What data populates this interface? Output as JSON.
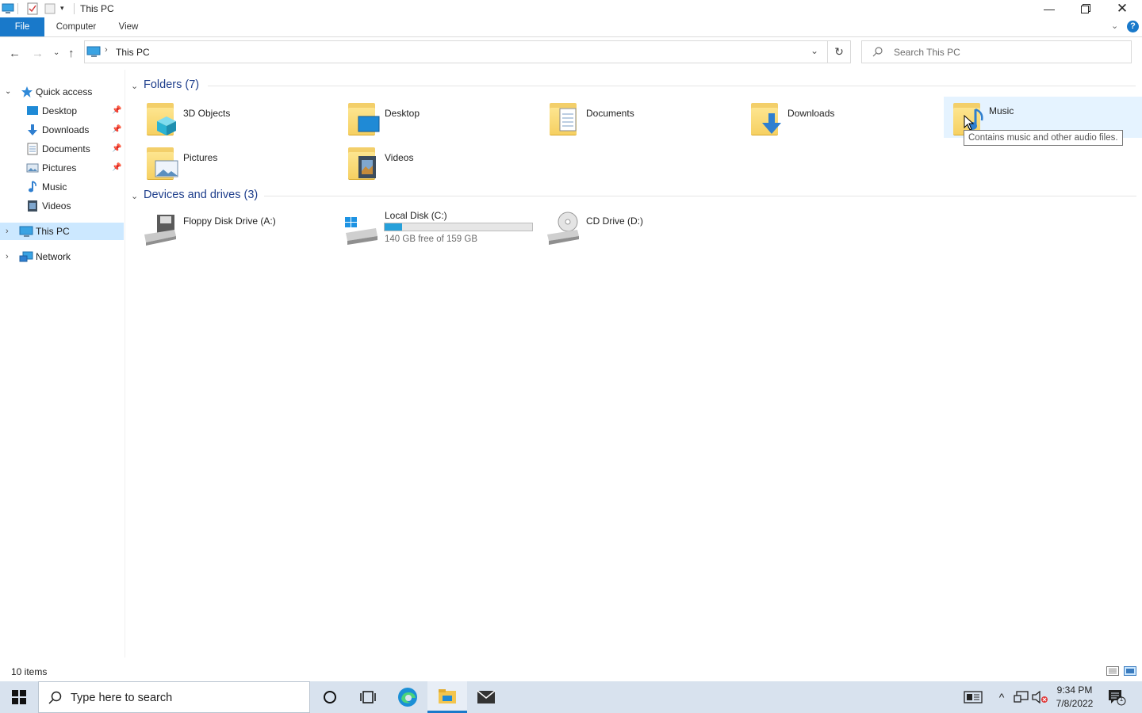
{
  "window": {
    "title": "This PC",
    "buttons": [
      "minimize",
      "restore",
      "close"
    ]
  },
  "ribbon": {
    "tabs": [
      {
        "label": "File",
        "active": true
      },
      {
        "label": "Computer"
      },
      {
        "label": "View"
      }
    ]
  },
  "address": {
    "path": "This PC",
    "search_placeholder": "Search This PC"
  },
  "nav_pane": {
    "quick_access": "Quick access",
    "pinned": [
      {
        "label": "Desktop",
        "icon": "desktop-icon",
        "pinned": true
      },
      {
        "label": "Downloads",
        "icon": "downloads-icon",
        "pinned": true
      },
      {
        "label": "Documents",
        "icon": "documents-icon",
        "pinned": true
      },
      {
        "label": "Pictures",
        "icon": "pictures-icon",
        "pinned": true
      },
      {
        "label": "Music",
        "icon": "music-icon",
        "pinned": false
      },
      {
        "label": "Videos",
        "icon": "videos-icon",
        "pinned": false
      }
    ],
    "this_pc": "This PC",
    "network": "Network"
  },
  "folders": {
    "header": "Folders (7)",
    "items": [
      {
        "label": "3D Objects",
        "icon": "3d-objects-folder-icon"
      },
      {
        "label": "Desktop",
        "icon": "desktop-folder-icon"
      },
      {
        "label": "Documents",
        "icon": "documents-folder-icon"
      },
      {
        "label": "Downloads",
        "icon": "downloads-folder-icon"
      },
      {
        "label": "Music",
        "icon": "music-folder-icon",
        "hovered": true
      },
      {
        "label": "Pictures",
        "icon": "pictures-folder-icon"
      },
      {
        "label": "Videos",
        "icon": "videos-folder-icon"
      }
    ]
  },
  "tooltip": "Contains music and other audio files.",
  "drives": {
    "header": "Devices and drives (3)",
    "items": [
      {
        "label": "Floppy Disk Drive (A:)",
        "icon": "floppy-drive-icon"
      },
      {
        "label": "Local Disk (C:)",
        "icon": "local-disk-icon",
        "free_text": "140 GB free of 159 GB",
        "used_fraction": 0.12
      },
      {
        "label": "CD Drive (D:)",
        "icon": "cd-drive-icon"
      }
    ]
  },
  "status": {
    "items_count": "10 items"
  },
  "taskbar": {
    "search_placeholder": "Type here to search",
    "time": "9:34 PM",
    "date": "7/8/2022",
    "notification_count": "1"
  },
  "colors": {
    "accent": "#1979ca",
    "group_header": "#1e3e8c",
    "selection": "#cce8ff",
    "hover": "#e5f3ff",
    "taskbar": "#d8e2ee",
    "drive_bar": "#26a0da"
  }
}
